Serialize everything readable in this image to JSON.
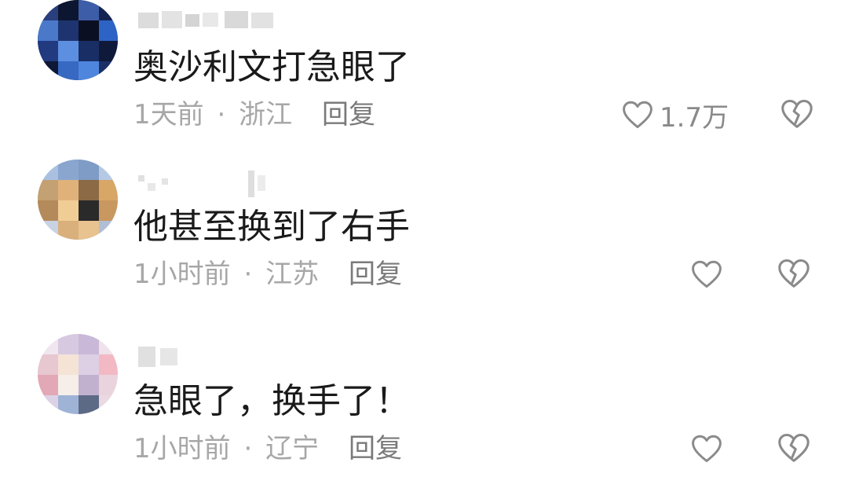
{
  "comments": [
    {
      "username": "",
      "text": "奥沙利文打急眼了",
      "time": "1天前",
      "separator": "·",
      "location": "浙江",
      "reply_label": "回复",
      "likes": "1.7万",
      "like_icon": "heart-outline-icon",
      "dislike_icon": "broken-heart-icon"
    },
    {
      "username": "",
      "text": "他甚至换到了右手",
      "time": "1小时前",
      "separator": "·",
      "location": "江苏",
      "reply_label": "回复",
      "likes": "",
      "like_icon": "heart-outline-icon",
      "dislike_icon": "broken-heart-icon"
    },
    {
      "username": "",
      "text": "急眼了，换手了！",
      "time": "1小时前",
      "separator": "·",
      "location": "辽宁",
      "reply_label": "回复",
      "likes": "",
      "like_icon": "heart-outline-icon",
      "dislike_icon": "broken-heart-icon"
    }
  ],
  "colors": {
    "text": "#1a1a1a",
    "meta": "#a7a7a7",
    "reply": "#7a7a7a",
    "icon": "#8a8a8a"
  }
}
